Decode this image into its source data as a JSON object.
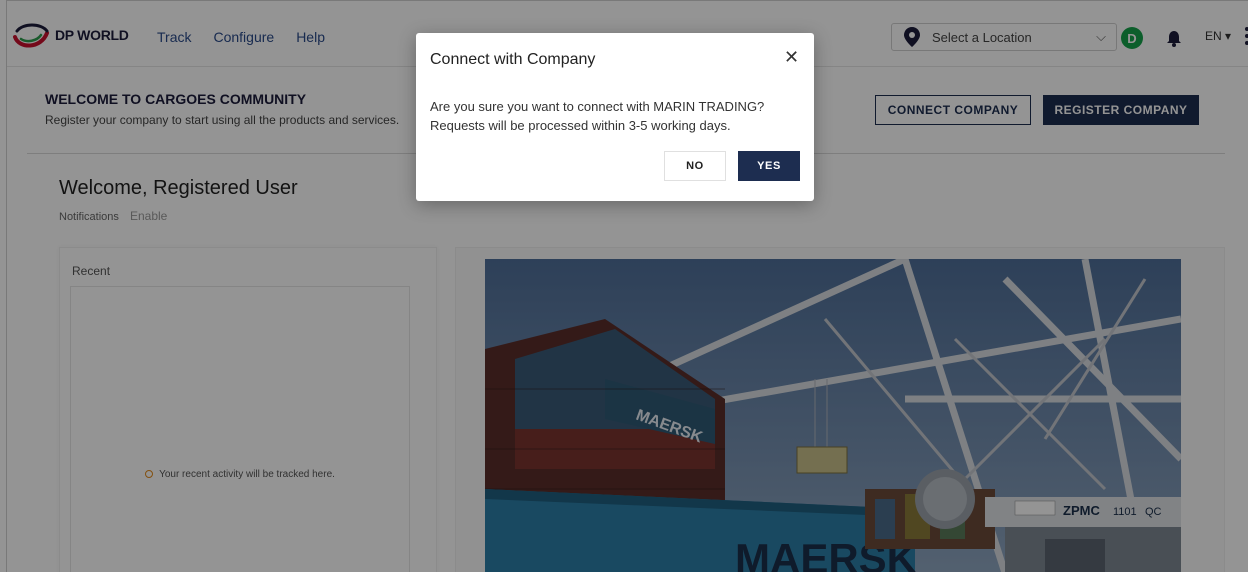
{
  "nav": {
    "brand": "DP WORLD",
    "links": [
      "Track",
      "Configure",
      "Help"
    ],
    "location_placeholder": "Select a Location",
    "user_initial": "D",
    "language": "EN ▾"
  },
  "banner": {
    "title": "WELCOME TO CARGOES COMMUNITY",
    "subtitle": "Register your company to start using all the products and services.",
    "connect_label": "CONNECT COMPANY",
    "register_label": "REGISTER COMPANY"
  },
  "main": {
    "welcome": "Welcome, Registered User",
    "notifications_label": "Notifications",
    "enable_label": "Enable",
    "recent_label": "Recent",
    "recent_empty": "Your recent activity will be tracked here."
  },
  "photo": {
    "ship_text": "MAERSK",
    "crane_brand": "ZPMC",
    "crane_number": "1101",
    "crane_code": "QC"
  },
  "modal": {
    "title": "Connect with Company",
    "body_line1": "Are you sure you want to connect with MARIN TRADING?",
    "body_line2": "Requests will be processed within 3-5 working days.",
    "no_label": "NO",
    "yes_label": "YES"
  },
  "colors": {
    "navy": "#1d2d50",
    "avatar_green": "#16a34a",
    "link_blue": "#2a4a8a",
    "warning_orange": "#e38b1a"
  }
}
